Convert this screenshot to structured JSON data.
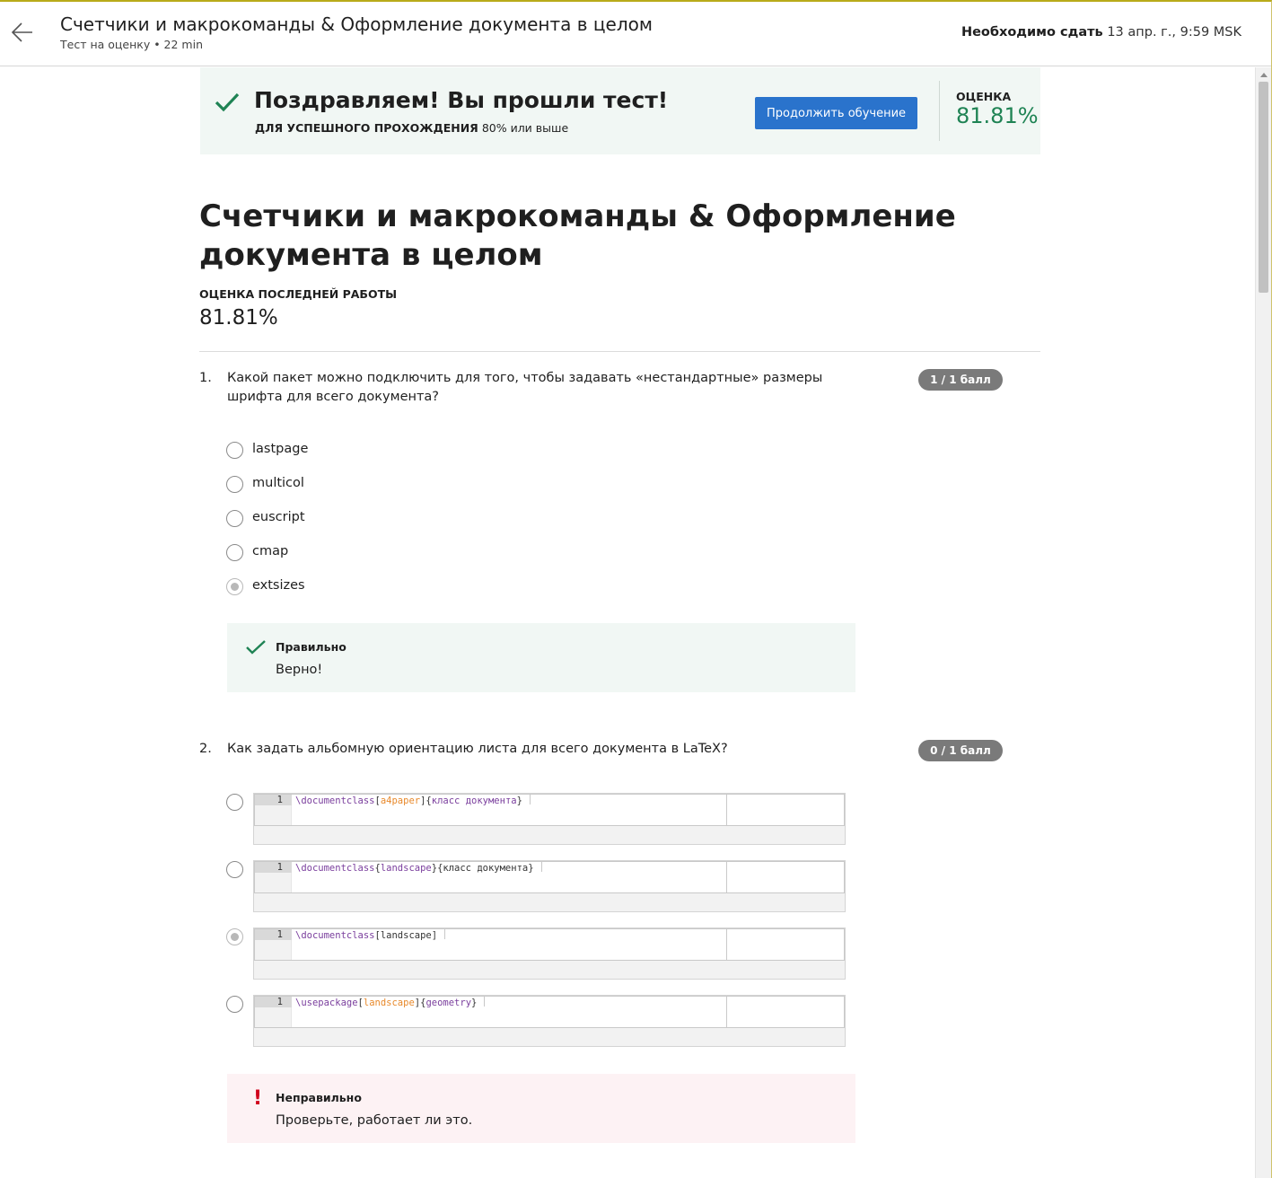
{
  "header": {
    "title": "Счетчики и макрокоманды & Оформление документа в целом",
    "subtitle": "Тест на оценку • 22 min",
    "due_label": "Необходимо сдать",
    "due_value": "13 апр. г., 9:59 MSK"
  },
  "banner": {
    "title": "Поздравляем! Вы прошли тест!",
    "req_label": "ДЛЯ УСПЕШНОГО ПРОХОЖДЕНИЯ",
    "req_value": "80% или выше",
    "continue_label": "Продолжить обучение",
    "grade_label": "ОЦЕНКА",
    "grade_value": "81.81%"
  },
  "main": {
    "title": "Счетчики и макрокоманды & Оформление документа в целом",
    "latest_label": "ОЦЕНКА ПОСЛЕДНЕЙ РАБОТЫ",
    "latest_value": "81.81%"
  },
  "q1": {
    "number": "1.",
    "text": "Какой пакет можно подключить для того, чтобы задавать «нестандартные» размеры шрифта для всего документа?",
    "score": "1 / 1 балл",
    "options": [
      "lastpage",
      "multicol",
      "euscript",
      "cmap",
      "extsizes"
    ],
    "selected_index": 4,
    "feedback_title": "Правильно",
    "feedback_text": "Верно!"
  },
  "q2": {
    "number": "2.",
    "text": "Как задать альбомную ориентацию листа для всего документа в LaTeX?",
    "score": "0 / 1 балл",
    "line_number": "1",
    "options": [
      [
        {
          "t": "\\documentclass",
          "c": "cmd"
        },
        {
          "t": "[",
          "c": "plain"
        },
        {
          "t": "a4paper",
          "c": "opt"
        },
        {
          "t": "]{",
          "c": "plain"
        },
        {
          "t": "класс документа",
          "c": "cmd"
        },
        {
          "t": "}",
          "c": "plain"
        }
      ],
      [
        {
          "t": "\\documentclass",
          "c": "cmd"
        },
        {
          "t": "{",
          "c": "plain"
        },
        {
          "t": "landscape",
          "c": "cmd"
        },
        {
          "t": "}{класс документа}",
          "c": "plain"
        }
      ],
      [
        {
          "t": "\\documentclass",
          "c": "cmd"
        },
        {
          "t": "[landscape]",
          "c": "plain"
        }
      ],
      [
        {
          "t": "\\usepackage",
          "c": "cmd"
        },
        {
          "t": "[",
          "c": "plain"
        },
        {
          "t": "landscape",
          "c": "opt"
        },
        {
          "t": "]{",
          "c": "plain"
        },
        {
          "t": "geometry",
          "c": "cmd"
        },
        {
          "t": "}",
          "c": "plain"
        }
      ]
    ],
    "selected_index": 2,
    "feedback_title": "Неправильно",
    "feedback_text": "Проверьте, работает ли это."
  },
  "colors": {
    "accent": "#2a73cc",
    "success": "#1f8354",
    "error": "#d0021b",
    "pill": "#7a7a7a"
  },
  "icons": [
    "back-arrow-icon",
    "check-icon",
    "exclamation-icon",
    "radio-icon"
  ]
}
